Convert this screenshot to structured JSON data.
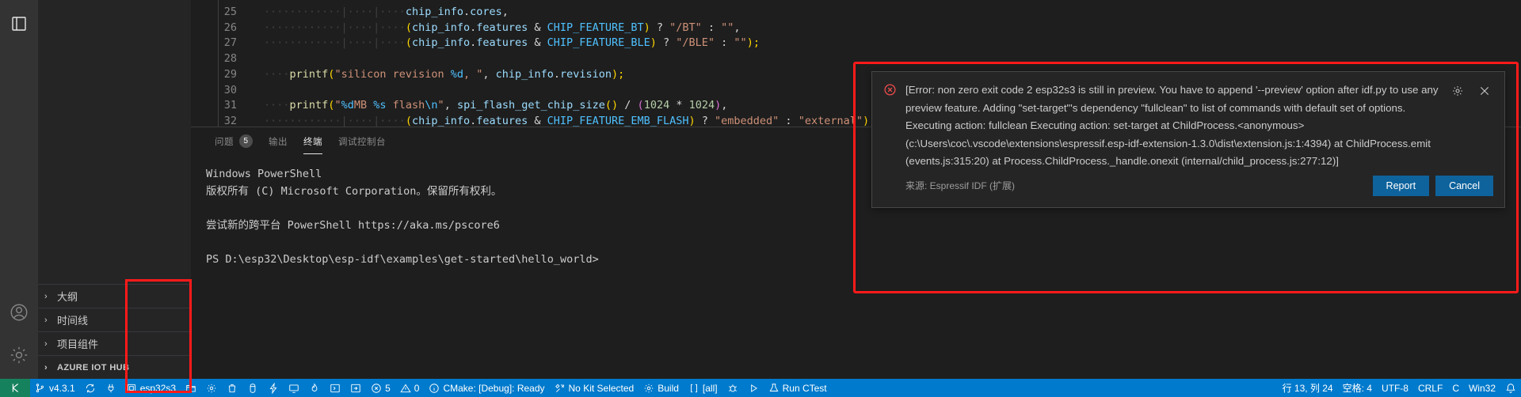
{
  "activitybar": {
    "top_icons": [
      {
        "name": "explorer-icon",
        "glyph": "files"
      }
    ],
    "bottom_icons": [
      {
        "name": "accounts-icon",
        "glyph": "account"
      },
      {
        "name": "settings-gear-icon",
        "glyph": "gear"
      }
    ]
  },
  "sidebar": {
    "sections": [
      {
        "label": "大纲",
        "chevron": "›",
        "caps": false
      },
      {
        "label": "时间线",
        "chevron": "›",
        "caps": false
      },
      {
        "label": "项目组件",
        "chevron": "›",
        "caps": false
      },
      {
        "label": "AZURE IOT HUB",
        "chevron": "›",
        "caps": true
      }
    ]
  },
  "editor": {
    "lines": [
      {
        "num": "25",
        "tokens": [
          {
            "t": "············|····|····",
            "c": "ind"
          },
          {
            "t": "chip_info",
            "c": "var"
          },
          {
            "t": ".",
            "c": "op"
          },
          {
            "t": "cores",
            "c": "var"
          },
          {
            "t": ",",
            "c": "op"
          }
        ]
      },
      {
        "num": "26",
        "tokens": [
          {
            "t": "············|····|····",
            "c": "ind"
          },
          {
            "t": "(",
            "c": "par"
          },
          {
            "t": "chip_info",
            "c": "var"
          },
          {
            "t": ".",
            "c": "op"
          },
          {
            "t": "features",
            "c": "var"
          },
          {
            "t": " & ",
            "c": "op"
          },
          {
            "t": "CHIP_FEATURE_BT",
            "c": "mac"
          },
          {
            "t": ")",
            "c": "par"
          },
          {
            "t": " ? ",
            "c": "op"
          },
          {
            "t": "\"/BT\"",
            "c": "str"
          },
          {
            "t": " : ",
            "c": "op"
          },
          {
            "t": "\"\"",
            "c": "str"
          },
          {
            "t": ",",
            "c": "op"
          }
        ]
      },
      {
        "num": "27",
        "tokens": [
          {
            "t": "············|····|····",
            "c": "ind"
          },
          {
            "t": "(",
            "c": "par"
          },
          {
            "t": "chip_info",
            "c": "var"
          },
          {
            "t": ".",
            "c": "op"
          },
          {
            "t": "features",
            "c": "var"
          },
          {
            "t": " & ",
            "c": "op"
          },
          {
            "t": "CHIP_FEATURE_BLE",
            "c": "mac"
          },
          {
            "t": ")",
            "c": "par"
          },
          {
            "t": " ? ",
            "c": "op"
          },
          {
            "t": "\"/BLE\"",
            "c": "str"
          },
          {
            "t": " : ",
            "c": "op"
          },
          {
            "t": "\"\"",
            "c": "str"
          },
          {
            "t": ");",
            "c": "par"
          }
        ]
      },
      {
        "num": "28",
        "tokens": []
      },
      {
        "num": "29",
        "tokens": [
          {
            "t": "····",
            "c": "ind"
          },
          {
            "t": "printf",
            "c": "fn"
          },
          {
            "t": "(",
            "c": "par"
          },
          {
            "t": "\"silicon revision ",
            "c": "str"
          },
          {
            "t": "%d",
            "c": "mac"
          },
          {
            "t": ", \"",
            "c": "str"
          },
          {
            "t": ", ",
            "c": "op"
          },
          {
            "t": "chip_info",
            "c": "var"
          },
          {
            "t": ".",
            "c": "op"
          },
          {
            "t": "revision",
            "c": "var"
          },
          {
            "t": ");",
            "c": "par"
          }
        ]
      },
      {
        "num": "30",
        "tokens": []
      },
      {
        "num": "31",
        "tokens": [
          {
            "t": "····",
            "c": "ind"
          },
          {
            "t": "printf",
            "c": "fn"
          },
          {
            "t": "(",
            "c": "par"
          },
          {
            "t": "\"",
            "c": "str"
          },
          {
            "t": "%d",
            "c": "mac"
          },
          {
            "t": "MB ",
            "c": "str"
          },
          {
            "t": "%s",
            "c": "mac"
          },
          {
            "t": " flash",
            "c": "str"
          },
          {
            "t": "\\n",
            "c": "mac"
          },
          {
            "t": "\"",
            "c": "str"
          },
          {
            "t": ", ",
            "c": "op"
          },
          {
            "t": "spi_flash_get_chip_size",
            "c": "var"
          },
          {
            "t": "()",
            "c": "par"
          },
          {
            "t": " / ",
            "c": "op"
          },
          {
            "t": "(",
            "c": "par2"
          },
          {
            "t": "1024",
            "c": "num"
          },
          {
            "t": " * ",
            "c": "op"
          },
          {
            "t": "1024",
            "c": "num"
          },
          {
            "t": ")",
            "c": "par2"
          },
          {
            "t": ",",
            "c": "op"
          }
        ]
      },
      {
        "num": "32",
        "tokens": [
          {
            "t": "············|····|····",
            "c": "ind"
          },
          {
            "t": "(",
            "c": "par"
          },
          {
            "t": "chip_info",
            "c": "var"
          },
          {
            "t": ".",
            "c": "op"
          },
          {
            "t": "features",
            "c": "var"
          },
          {
            "t": " & ",
            "c": "op"
          },
          {
            "t": "CHIP_FEATURE_EMB_FLASH",
            "c": "mac"
          },
          {
            "t": ")",
            "c": "par"
          },
          {
            "t": " ? ",
            "c": "op"
          },
          {
            "t": "\"embedded\"",
            "c": "str"
          },
          {
            "t": " : ",
            "c": "op"
          },
          {
            "t": "\"external\"",
            "c": "str"
          },
          {
            "t": ");",
            "c": "par"
          }
        ]
      }
    ]
  },
  "panel": {
    "tabs": [
      {
        "label": "问题",
        "badge": "5",
        "active": false
      },
      {
        "label": "输出",
        "badge": null,
        "active": false
      },
      {
        "label": "终端",
        "badge": null,
        "active": true
      },
      {
        "label": "调试控制台",
        "badge": null,
        "active": false
      }
    ],
    "terminal_lines": [
      "Windows PowerShell",
      "版权所有 (C) Microsoft Corporation。保留所有权利。",
      "",
      "尝试新的跨平台 PowerShell https://aka.ms/pscore6",
      "",
      "PS D:\\esp32\\Desktop\\esp-idf\\examples\\get-started\\hello_world>"
    ]
  },
  "notification": {
    "severity_icon": "error-circle-icon",
    "message": "[Error: non zero exit code 2 esp32s3 is still in preview. You have to append '--preview' option after idf.py to use any preview feature. Adding \"set-target\"'s dependency \"fullclean\" to list of commands with default set of options. Executing action: fullclean Executing action: set-target at ChildProcess.<anonymous> (c:\\Users\\coc\\.vscode\\extensions\\espressif.esp-idf-extension-1.3.0\\dist\\extension.js:1:4394) at ChildProcess.emit (events.js:315:20) at Process.ChildProcess._handle.onexit (internal/child_process.js:277:12)]",
    "source": "来源: Espressif IDF (扩展)",
    "gear_icon": "gear-icon",
    "close_icon": "close-icon",
    "buttons": [
      {
        "label": "Report"
      },
      {
        "label": "Cancel"
      }
    ],
    "highlight_color": "#ff1a1a",
    "button_color": "#0e639c"
  },
  "statusbar": {
    "remote_icon": "remote-window-icon",
    "left_items": [
      {
        "icon": "source-control-icon",
        "label": "v4.3.1"
      },
      {
        "icon": "sync-icon",
        "label": ""
      },
      {
        "icon": "plug-icon",
        "label": ""
      },
      {
        "icon": "chip-icon",
        "label": "esp32s3",
        "highlighted": true
      },
      {
        "icon": "folder-icon",
        "label": ""
      },
      {
        "icon": "gear-icon",
        "label": ""
      },
      {
        "icon": "trash-icon",
        "label": ""
      },
      {
        "icon": "database-icon",
        "label": ""
      },
      {
        "icon": "flash-icon",
        "label": ""
      },
      {
        "icon": "monitor-icon",
        "label": ""
      },
      {
        "icon": "flame-icon",
        "label": ""
      },
      {
        "icon": "terminal-bracket-icon",
        "label": ""
      },
      {
        "icon": "arrow-into-box-icon",
        "label": ""
      },
      {
        "icon": "error-icon",
        "label": "5"
      },
      {
        "icon": "warning-icon",
        "label": "0"
      },
      {
        "icon": "info-icon",
        "label": "CMake: [Debug]: Ready"
      },
      {
        "icon": "tools-icon",
        "label": "No Kit Selected"
      },
      {
        "icon": "gear-icon",
        "label": "Build"
      },
      {
        "icon": "bracket-icon",
        "label": "[all]"
      },
      {
        "icon": "bug-icon",
        "label": ""
      },
      {
        "icon": "play-icon",
        "label": ""
      },
      {
        "icon": "beaker-icon",
        "label": "Run CTest"
      }
    ],
    "right_items": [
      {
        "label": "行 13, 列 24"
      },
      {
        "label": "空格: 4"
      },
      {
        "label": "UTF-8"
      },
      {
        "label": "CRLF"
      },
      {
        "label": "C"
      },
      {
        "label": "Win32"
      },
      {
        "icon": "bell-icon",
        "label": ""
      }
    ],
    "accent_color": "#007acc",
    "remote_color": "#16825d"
  }
}
